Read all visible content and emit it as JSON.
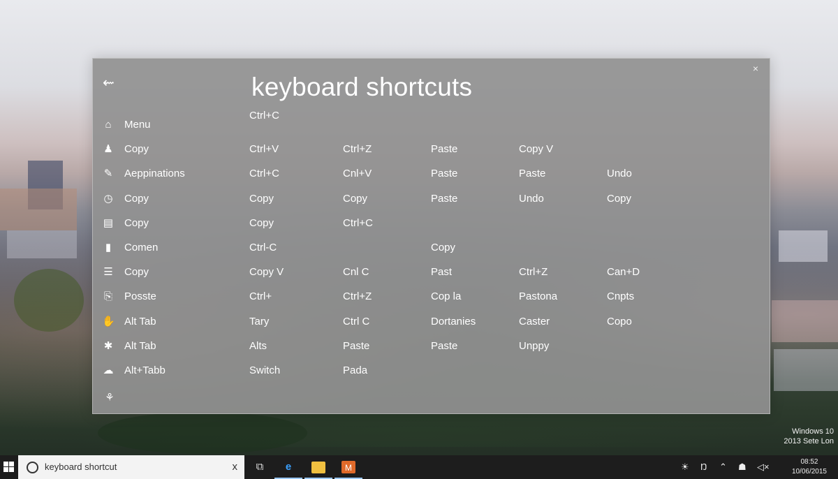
{
  "dialog": {
    "title": "keyboard shortcuts",
    "close_label": "×",
    "back_label": "⇜",
    "sub_line": "Ctrl+C",
    "rows": [
      {
        "icon": "home-icon",
        "glyph": "⌂",
        "name": "Menu",
        "cells": [
          "",
          "",
          "",
          "",
          ""
        ]
      },
      {
        "icon": "person-icon",
        "glyph": "♟",
        "name": "Copy",
        "cells": [
          "Ctrl+V",
          "Ctrl+Z",
          "Paste",
          "Copy V",
          ""
        ]
      },
      {
        "icon": "pen-icon",
        "glyph": "✎",
        "name": "Aeppinations",
        "cells": [
          "Ctrl+C",
          "Cnl+V",
          "Paste",
          "Paste",
          "Undo"
        ]
      },
      {
        "icon": "clock-icon",
        "glyph": "◷",
        "name": "Copy",
        "cells": [
          "Copy",
          "Copy",
          "Paste",
          "Undo",
          "Copy"
        ]
      },
      {
        "icon": "keyboard-icon",
        "glyph": "▤",
        "name": "Copy",
        "cells": [
          "Copy",
          "Ctrl+C",
          "",
          "",
          ""
        ]
      },
      {
        "icon": "document-icon",
        "glyph": "▮",
        "name": "Comen",
        "cells": [
          "Ctrl-C",
          "",
          "Copy",
          "",
          ""
        ]
      },
      {
        "icon": "list-icon",
        "glyph": "☰",
        "name": "Copy",
        "cells": [
          "Copy V",
          "Cnl C",
          "Past",
          "Ctrl+Z",
          "Can+D"
        ]
      },
      {
        "icon": "clipboard-icon",
        "glyph": "⎘",
        "name": "Posste",
        "cells": [
          "Ctrl+",
          "Ctrl+Z",
          "Cop la",
          "Pastona",
          "Cnpts"
        ]
      },
      {
        "icon": "hand-icon",
        "glyph": "✋",
        "name": "Alt Tab",
        "cells": [
          "Tary",
          "Ctrl C",
          "Dortanies",
          "Caster",
          "Copo"
        ]
      },
      {
        "icon": "gear-icon",
        "glyph": "✱",
        "name": "Alt Tab",
        "cells": [
          "Alts",
          "Paste",
          "Paste",
          "Unppy",
          ""
        ]
      },
      {
        "icon": "cloud-icon",
        "glyph": "☁",
        "name": "Alt+Tabb",
        "cells": [
          "Switch",
          "Pada",
          "",
          "",
          ""
        ]
      }
    ],
    "bottom_icon": "⚘"
  },
  "watermark": {
    "line1": "Windows 10",
    "line2": "2013 Sete Lon"
  },
  "taskbar": {
    "search_text": "keyboard shortcut",
    "search_clear": "x",
    "task_view_glyph": "⧉",
    "edge_glyph": "e",
    "store_glyph": "M",
    "tray": [
      "☀",
      "Ŋ",
      "⌃",
      "☗",
      "◁×"
    ],
    "clock_time": "08:52",
    "clock_date": "10/06/2015"
  },
  "colors": {
    "dialog_bg": "#919191",
    "taskbar_bg": "#1d1d1d",
    "search_bg": "#f3f3f3"
  }
}
